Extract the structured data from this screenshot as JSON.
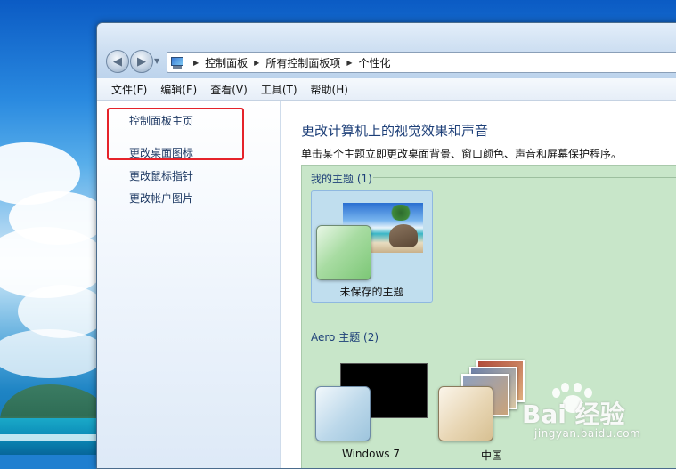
{
  "window": {
    "breadcrumbs": [
      "控制面板",
      "所有控制面板项",
      "个性化"
    ]
  },
  "menubar": {
    "items": [
      "文件(F)",
      "编辑(E)",
      "查看(V)",
      "工具(T)",
      "帮助(H)"
    ]
  },
  "sidebar": {
    "links": [
      "控制面板主页",
      "更改桌面图标",
      "更改鼠标指针",
      "更改帐户图片"
    ]
  },
  "main": {
    "heading": "更改计算机上的视觉效果和声音",
    "description": "单击某个主题立即更改桌面背景、窗口颜色、声音和屏幕保护程序。",
    "groups": [
      {
        "label": "我的主题 (1)",
        "themes": [
          {
            "name": "未保存的主题",
            "selected": true
          }
        ]
      },
      {
        "label": "Aero 主题 (2)",
        "themes": [
          {
            "name": "Windows 7"
          },
          {
            "name": "中国"
          }
        ]
      }
    ]
  },
  "watermark": {
    "brand": "Bai 经验",
    "url": "jingyan.baidu.com"
  },
  "colors": {
    "annotation_box": "#e5232a",
    "heading": "#1d3f78",
    "theme_area": "#c8e6c9"
  }
}
